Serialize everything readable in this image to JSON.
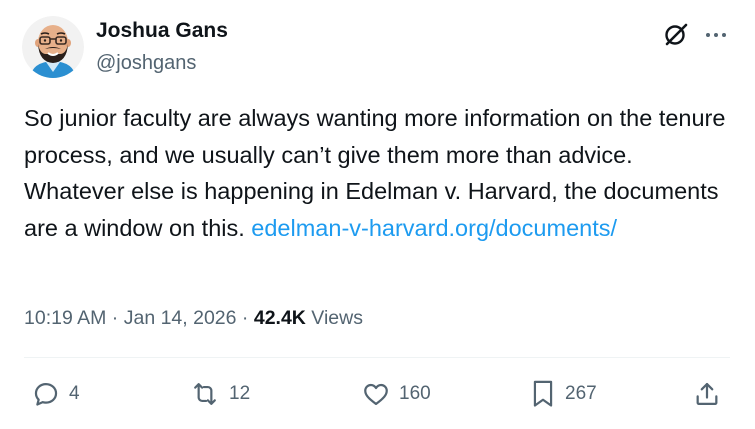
{
  "author": {
    "name": "Joshua Gans",
    "handle": "@joshgans"
  },
  "tweet": {
    "text_main": "So junior faculty are always wanting more information on the tenure process, and we usually can’t give them more than advice. Whatever else is happening in Edelman v. Harvard, the documents are a window on this. ",
    "link": "edelman-v-harvard.org/documents/"
  },
  "meta": {
    "time": "10:19 AM",
    "sep1": " · ",
    "date": "Jan 14, 2026",
    "sep2": " · ",
    "views_count": "42.4K",
    "views_label": " Views"
  },
  "actions": {
    "replies": "4",
    "reposts": "12",
    "likes": "160",
    "bookmarks": "267"
  },
  "icons": {
    "header": [
      "grok-icon",
      "more-icon"
    ],
    "actions": [
      "reply-icon",
      "retweet-icon",
      "like-icon",
      "bookmark-icon",
      "share-icon"
    ]
  },
  "colors": {
    "text": "#0f1419",
    "secondary": "#536471",
    "link": "#1d9bf0",
    "divider": "#eff3f4"
  }
}
